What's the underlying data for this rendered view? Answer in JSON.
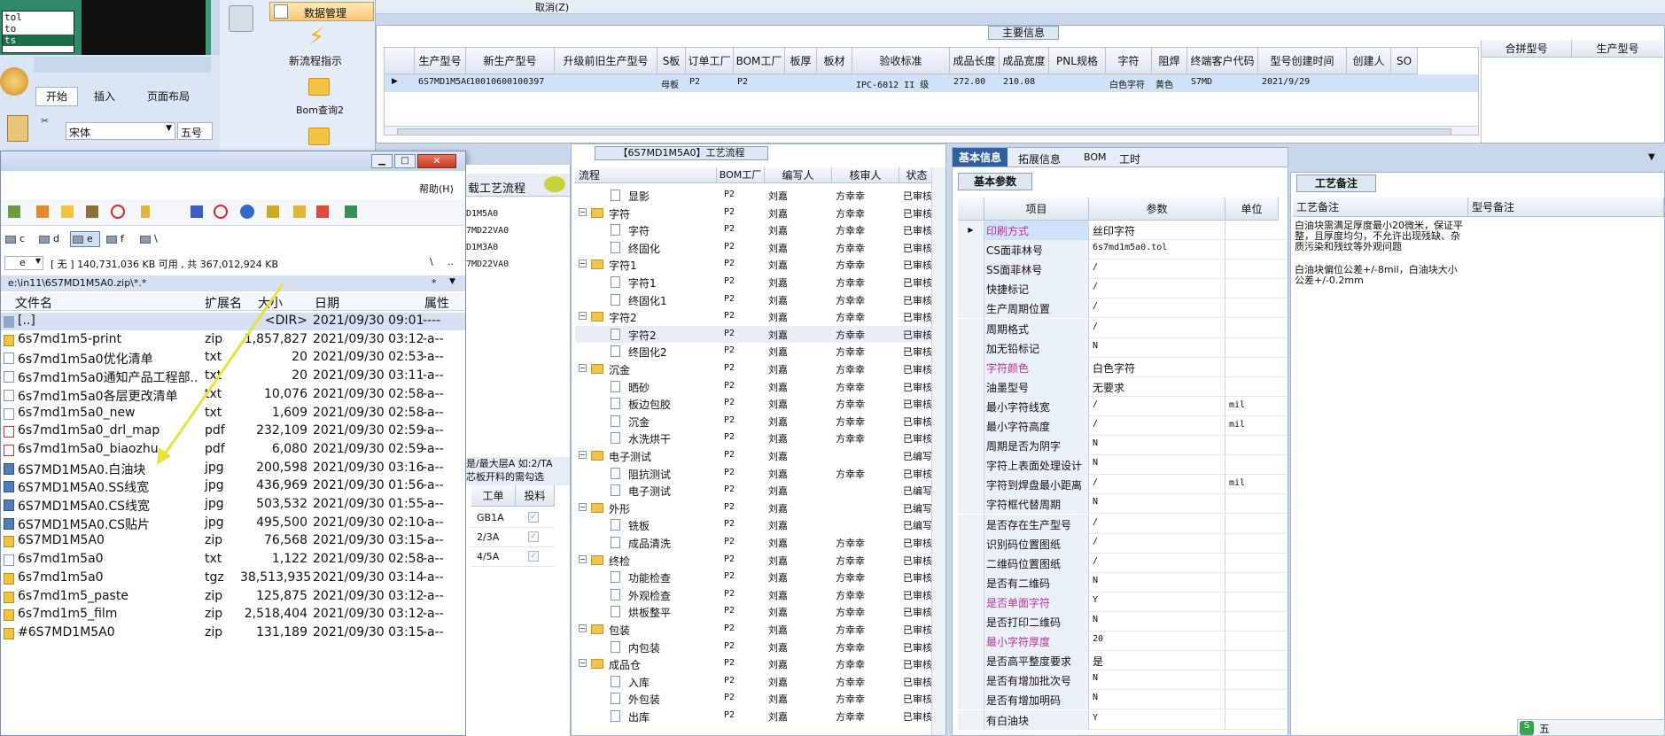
{
  "left_ribbon": {
    "tab_data_mgmt": "数据管理",
    "btn_new_flow": "新流程指示",
    "btn_bom": "Bom查询2"
  },
  "mini_list": [
    "tol",
    "to",
    "ts"
  ],
  "excel": {
    "tabs": [
      "开始",
      "插入",
      "页面布局"
    ],
    "font": "宋体",
    "size": "五号"
  },
  "top_grid": {
    "cancel": "取消(Z)",
    "section_title": "主要信息",
    "headers": [
      "生产型号",
      "新生产型号",
      "升级前旧生产型号",
      "S板",
      "订单工厂",
      "BOM工厂",
      "板厚",
      "板材",
      "验收标准",
      "成品长度",
      "成品宽度",
      "PNL规格",
      "字符",
      "阻焊",
      "终端客户代码",
      "型号创建时间",
      "创建人",
      "SO"
    ],
    "row": [
      "6S7MD1M5A0",
      "10010600100397",
      "",
      "母板",
      "P2",
      "P2",
      "",
      "",
      "IPC-6012 II 级",
      "272.00",
      "210.08",
      "",
      "白色字符",
      "黄色",
      "S7MD",
      "2021/9/29",
      "",
      ""
    ],
    "side_headers": [
      "合拼型号",
      "生产型号"
    ]
  },
  "zip_window": {
    "help": "帮助(H)",
    "drives": [
      "c",
      "d",
      "e",
      "f",
      "\\"
    ],
    "drive_sel": "e",
    "free_text": "[ 无 ]  140,731,036 KB 可用 , 共 367,012,924 KB",
    "path": "e:\\in11\\6S7MD1M5A0.zip\\*.*",
    "cols": [
      "文件名",
      "扩展名",
      "大小",
      "日期",
      "属性"
    ],
    "files": [
      {
        "name": "[..]",
        "ext": "",
        "size": "<DIR>",
        "date": "2021/09/30 09:01",
        "attr": "----",
        "type": "up"
      },
      {
        "name": "6s7md1m5-print",
        "ext": "zip",
        "size": "1,857,827",
        "date": "2021/09/30 03:12",
        "attr": "-a--",
        "type": "zip"
      },
      {
        "name": "6s7md1m5a0优化清单",
        "ext": "txt",
        "size": "20",
        "date": "2021/09/30 02:53",
        "attr": "-a--",
        "type": "txt"
      },
      {
        "name": "6s7md1m5a0通知产品工程部..",
        "ext": "txt",
        "size": "20",
        "date": "2021/09/30 03:11",
        "attr": "-a--",
        "type": "txt"
      },
      {
        "name": "6s7md1m5a0各层更改清单",
        "ext": "txt",
        "size": "10,076",
        "date": "2021/09/30 02:58",
        "attr": "-a--",
        "type": "txt"
      },
      {
        "name": "6s7md1m5a0_new",
        "ext": "txt",
        "size": "1,609",
        "date": "2021/09/30 02:58",
        "attr": "-a--",
        "type": "txt"
      },
      {
        "name": "6s7md1m5a0_drl_map",
        "ext": "pdf",
        "size": "232,109",
        "date": "2021/09/30 02:59",
        "attr": "-a--",
        "type": "pdf"
      },
      {
        "name": "6s7md1m5a0_biaozhu",
        "ext": "pdf",
        "size": "6,080",
        "date": "2021/09/30 02:59",
        "attr": "-a--",
        "type": "pdf"
      },
      {
        "name": "6S7MD1M5A0.白油块",
        "ext": "jpg",
        "size": "200,598",
        "date": "2021/09/30 03:16",
        "attr": "-a--",
        "type": "jpg"
      },
      {
        "name": "6S7MD1M5A0.SS线宽",
        "ext": "jpg",
        "size": "436,969",
        "date": "2021/09/30 01:56",
        "attr": "-a--",
        "type": "jpg"
      },
      {
        "name": "6S7MD1M5A0.CS线宽",
        "ext": "jpg",
        "size": "503,532",
        "date": "2021/09/30 01:55",
        "attr": "-a--",
        "type": "jpg"
      },
      {
        "name": "6S7MD1M5A0.CS贴片",
        "ext": "jpg",
        "size": "495,500",
        "date": "2021/09/30 02:10",
        "attr": "-a--",
        "type": "jpg"
      },
      {
        "name": "6S7MD1M5A0",
        "ext": "zip",
        "size": "76,568",
        "date": "2021/09/30 03:15",
        "attr": "-a--",
        "type": "zip"
      },
      {
        "name": "6s7md1m5a0",
        "ext": "txt",
        "size": "1,122",
        "date": "2021/09/30 02:58",
        "attr": "-a--",
        "type": "txt"
      },
      {
        "name": "6s7md1m5a0",
        "ext": "tgz",
        "size": "38,513,935",
        "date": "2021/09/30 03:14",
        "attr": "-a--",
        "type": "zip"
      },
      {
        "name": "6s7md1m5_paste",
        "ext": "zip",
        "size": "125,875",
        "date": "2021/09/30 03:12",
        "attr": "-a--",
        "type": "zip"
      },
      {
        "name": "6s7md1m5_film",
        "ext": "zip",
        "size": "2,518,404",
        "date": "2021/09/30 03:12",
        "attr": "-a--",
        "type": "zip"
      },
      {
        "name": "#6S7MD1M5A0",
        "ext": "zip",
        "size": "131,189",
        "date": "2021/09/30 03:15",
        "attr": "-a--",
        "type": "zip"
      }
    ]
  },
  "mid_left": {
    "title": "载工艺流程",
    "items": [
      "D1M5A0",
      "7MD22VA0",
      "D1M3A0",
      "7MD22VA0"
    ],
    "note1": "是/最大层A 如:2/TA",
    "note2": "芯板开料的需勾选",
    "cols": [
      "工单",
      "投料"
    ],
    "rows": [
      "GB1A",
      "2/3A",
      "4/5A"
    ]
  },
  "flow": {
    "title": "【6S7MD1M5A0】工艺流程",
    "cols": [
      "流程",
      "BOM工厂",
      "编写人",
      "核审人",
      "状态"
    ],
    "rows": [
      {
        "level": 2,
        "name": "显影",
        "bom": "P2",
        "w": "刘嘉",
        "r": "方幸幸",
        "s": "已审核"
      },
      {
        "level": 1,
        "name": "字符",
        "bom": "P2",
        "w": "刘嘉",
        "r": "方幸幸",
        "s": "已审核"
      },
      {
        "level": 2,
        "name": "字符",
        "bom": "P2",
        "w": "刘嘉",
        "r": "方幸幸",
        "s": "已审核"
      },
      {
        "level": 2,
        "name": "终固化",
        "bom": "P2",
        "w": "刘嘉",
        "r": "方幸幸",
        "s": "已审核"
      },
      {
        "level": 1,
        "name": "字符1",
        "bom": "P2",
        "w": "刘嘉",
        "r": "方幸幸",
        "s": "已审核"
      },
      {
        "level": 2,
        "name": "字符1",
        "bom": "P2",
        "w": "刘嘉",
        "r": "方幸幸",
        "s": "已审核"
      },
      {
        "level": 2,
        "name": "终固化1",
        "bom": "P2",
        "w": "刘嘉",
        "r": "方幸幸",
        "s": "已审核"
      },
      {
        "level": 1,
        "name": "字符2",
        "bom": "P2",
        "w": "刘嘉",
        "r": "方幸幸",
        "s": "已审核"
      },
      {
        "level": 2,
        "name": "字符2",
        "bom": "P2",
        "w": "刘嘉",
        "r": "方幸幸",
        "s": "已审核",
        "sel": true
      },
      {
        "level": 2,
        "name": "终固化2",
        "bom": "P2",
        "w": "刘嘉",
        "r": "方幸幸",
        "s": "已审核"
      },
      {
        "level": 1,
        "name": "沉金",
        "bom": "P2",
        "w": "刘嘉",
        "r": "方幸幸",
        "s": "已审核"
      },
      {
        "level": 2,
        "name": "晒砂",
        "bom": "P2",
        "w": "刘嘉",
        "r": "方幸幸",
        "s": "已审核"
      },
      {
        "level": 2,
        "name": "板边包胶",
        "bom": "P2",
        "w": "刘嘉",
        "r": "方幸幸",
        "s": "已审核"
      },
      {
        "level": 2,
        "name": "沉金",
        "bom": "P2",
        "w": "刘嘉",
        "r": "方幸幸",
        "s": "已审核"
      },
      {
        "level": 2,
        "name": "水洗烘干",
        "bom": "P2",
        "w": "刘嘉",
        "r": "方幸幸",
        "s": "已审核"
      },
      {
        "level": 1,
        "name": "电子测试",
        "bom": "P2",
        "w": "刘嘉",
        "r": "",
        "s": "已编写"
      },
      {
        "level": 2,
        "name": "阻抗测试",
        "bom": "P2",
        "w": "刘嘉",
        "r": "方幸幸",
        "s": "已审核"
      },
      {
        "level": 2,
        "name": "电子测试",
        "bom": "P2",
        "w": "刘嘉",
        "r": "",
        "s": "已编写"
      },
      {
        "level": 1,
        "name": "外形",
        "bom": "P2",
        "w": "刘嘉",
        "r": "",
        "s": "已编写"
      },
      {
        "level": 2,
        "name": "铣板",
        "bom": "P2",
        "w": "刘嘉",
        "r": "",
        "s": "已编写"
      },
      {
        "level": 2,
        "name": "成品清洗",
        "bom": "P2",
        "w": "刘嘉",
        "r": "方幸幸",
        "s": "已审核"
      },
      {
        "level": 1,
        "name": "终检",
        "bom": "P2",
        "w": "刘嘉",
        "r": "方幸幸",
        "s": "已审核"
      },
      {
        "level": 2,
        "name": "功能检查",
        "bom": "P2",
        "w": "刘嘉",
        "r": "方幸幸",
        "s": "已审核"
      },
      {
        "level": 2,
        "name": "外观检查",
        "bom": "P2",
        "w": "刘嘉",
        "r": "方幸幸",
        "s": "已审核"
      },
      {
        "level": 2,
        "name": "烘板整平",
        "bom": "P2",
        "w": "刘嘉",
        "r": "方幸幸",
        "s": "已审核"
      },
      {
        "level": 1,
        "name": "包装",
        "bom": "P2",
        "w": "刘嘉",
        "r": "方幸幸",
        "s": "已审核"
      },
      {
        "level": 2,
        "name": "内包装",
        "bom": "P2",
        "w": "刘嘉",
        "r": "方幸幸",
        "s": "已审核"
      },
      {
        "level": 1,
        "name": "成品仓",
        "bom": "P2",
        "w": "刘嘉",
        "r": "方幸幸",
        "s": "已审核"
      },
      {
        "level": 2,
        "name": "入库",
        "bom": "P2",
        "w": "刘嘉",
        "r": "方幸幸",
        "s": "已审核"
      },
      {
        "level": 2,
        "name": "外包装",
        "bom": "P2",
        "w": "刘嘉",
        "r": "方幸幸",
        "s": "已审核"
      },
      {
        "level": 2,
        "name": "出库",
        "bom": "P2",
        "w": "刘嘉",
        "r": "方幸幸",
        "s": "已审核"
      }
    ]
  },
  "params": {
    "tabs": [
      "基本信息",
      "拓展信息",
      "BOM",
      "工时"
    ],
    "sub_tab": "基本参数",
    "cols": [
      "项目",
      "参数",
      "单位"
    ],
    "rows": [
      {
        "k": "印刷方式",
        "v": "丝印字符",
        "u": "",
        "pink": true,
        "sel": true
      },
      {
        "k": "CS面菲林号",
        "v": "6s7md1m5a0.tol",
        "u": ""
      },
      {
        "k": "SS面菲林号",
        "v": "/",
        "u": ""
      },
      {
        "k": "快捷标记",
        "v": "/",
        "u": ""
      },
      {
        "k": "生产周期位置",
        "v": "/",
        "u": ""
      },
      {
        "k": "周期格式",
        "v": "/",
        "u": ""
      },
      {
        "k": "加无铅标记",
        "v": "N",
        "u": ""
      },
      {
        "k": "字符颜色",
        "v": "白色字符",
        "u": "",
        "pink": true
      },
      {
        "k": "油墨型号",
        "v": "无要求",
        "u": ""
      },
      {
        "k": "最小字符线宽",
        "v": "/",
        "u": "mil"
      },
      {
        "k": "最小字符高度",
        "v": "/",
        "u": "mil"
      },
      {
        "k": "周期是否为阴字",
        "v": "N",
        "u": ""
      },
      {
        "k": "字符上表面处理设计",
        "v": "N",
        "u": ""
      },
      {
        "k": "字符到焊盘最小距离",
        "v": "/",
        "u": "mil"
      },
      {
        "k": "字符框代替周期",
        "v": "N",
        "u": ""
      },
      {
        "k": "是否存在生产型号",
        "v": "/",
        "u": ""
      },
      {
        "k": "识别码位置图纸",
        "v": "/",
        "u": ""
      },
      {
        "k": "二维码位置图纸",
        "v": "/",
        "u": ""
      },
      {
        "k": "是否有二维码",
        "v": "N",
        "u": ""
      },
      {
        "k": "是否单面字符",
        "v": "Y",
        "u": "",
        "pink": true
      },
      {
        "k": "是否打印二维码",
        "v": "N",
        "u": ""
      },
      {
        "k": "最小字符厚度",
        "v": "20",
        "u": "",
        "pink": true
      },
      {
        "k": "是否高平整度要求",
        "v": "是",
        "u": ""
      },
      {
        "k": "是否有增加批次号",
        "v": "N",
        "u": ""
      },
      {
        "k": "是否有增加明码",
        "v": "N",
        "u": ""
      },
      {
        "k": "有白油块",
        "v": "Y",
        "u": ""
      }
    ]
  },
  "remarks": {
    "tab": "工艺备注",
    "col1": "工艺备注",
    "col2": "型号备注",
    "text1": "白油块需满足厚度最小20微米，保证平整，且厚度均匀，不允许出现残缺、杂质污染和残纹等外观问题",
    "text2": "白油块偏位公差+/-8mil，白油块大小公差+/-0.2mm"
  },
  "tray": {
    "text": "五"
  }
}
